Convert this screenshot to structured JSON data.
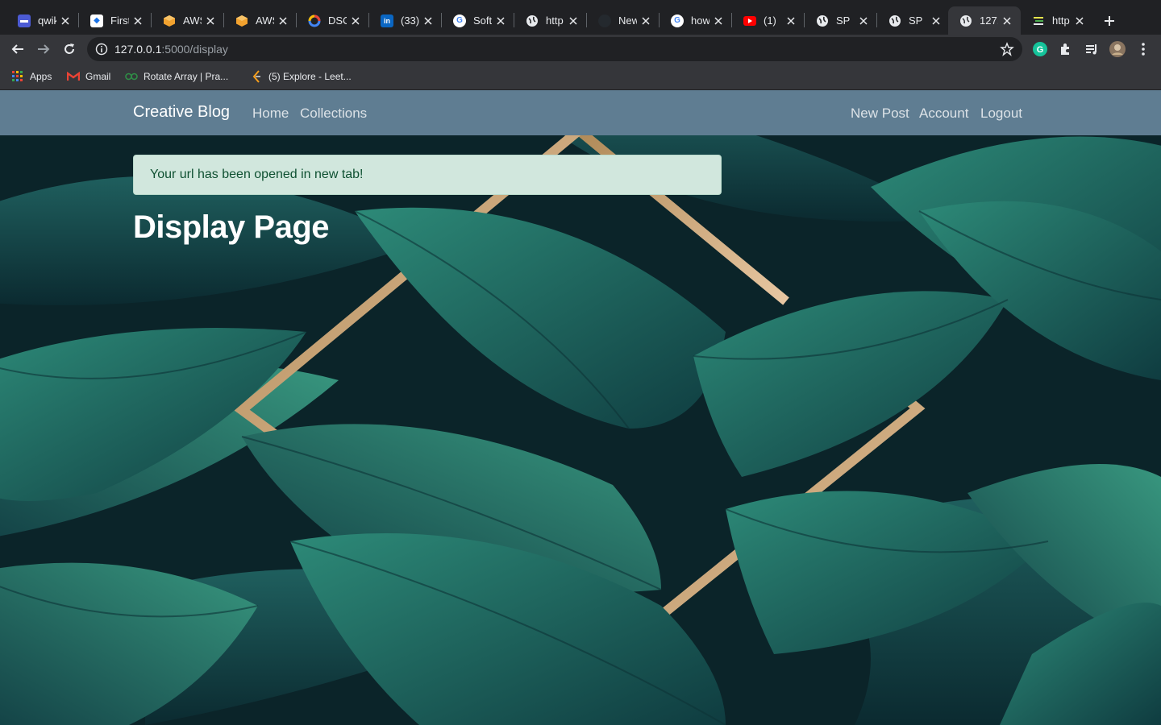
{
  "browser": {
    "tabs": [
      {
        "title": "qwik",
        "favicon": "qwiklabs-icon",
        "color": "#4c5bd4"
      },
      {
        "title": "First",
        "favicon": "workspace-icon",
        "color": "#ffffff"
      },
      {
        "title": "AWS",
        "favicon": "aws-cube-icon",
        "color": "#f2a22f"
      },
      {
        "title": "AWS",
        "favicon": "aws-cube-icon",
        "color": "#f2a22f"
      },
      {
        "title": "DSC",
        "favicon": "dsc-icon",
        "color": "#4285f4"
      },
      {
        "title": "(33)",
        "favicon": "linkedin-icon",
        "color": "#0a66c2"
      },
      {
        "title": "Soft",
        "favicon": "google-icon",
        "color": "#ffffff"
      },
      {
        "title": "http",
        "favicon": "globe-icon",
        "color": "#ffffff"
      },
      {
        "title": "New",
        "favicon": "github-icon",
        "color": "#24292e"
      },
      {
        "title": "how",
        "favicon": "google-icon",
        "color": "#ffffff"
      },
      {
        "title": "(1)",
        "favicon": "youtube-icon",
        "color": "#ff0000"
      },
      {
        "title": "SP",
        "favicon": "globe-icon",
        "color": "#ffffff"
      },
      {
        "title": "SP",
        "favicon": "globe-icon",
        "color": "#ffffff"
      },
      {
        "title": "127.",
        "favicon": "globe-icon",
        "color": "#ffffff",
        "active": true
      },
      {
        "title": "http",
        "favicon": "bookmark-list-icon",
        "color": "#e6e64c"
      }
    ],
    "url_host": "127.0.0.1",
    "url_path": ":5000/display",
    "bookmarks": [
      {
        "label": "Apps",
        "icon": "apps-grid-icon"
      },
      {
        "label": "Gmail",
        "icon": "gmail-icon"
      },
      {
        "label": "Rotate Array | Pra...",
        "icon": "gfg-icon"
      },
      {
        "label": "(5) Explore - Leet...",
        "icon": "leetcode-icon"
      }
    ],
    "accent": "#35363a"
  },
  "site": {
    "brand": "Creative Blog",
    "nav_left": [
      "Home",
      "Collections"
    ],
    "nav_right": [
      "New Post",
      "Account",
      "Logout"
    ],
    "navbar_color": "#5f7d92",
    "alert_message": "Your url has been opened in new tab!",
    "alert_color": "#d1e7dd",
    "page_title": "Display Page"
  }
}
